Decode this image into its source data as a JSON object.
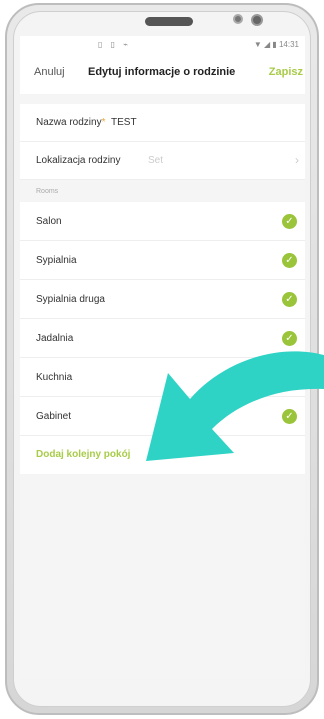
{
  "status_bar": {
    "left_icons": "▯ ▯ ⌁",
    "right_text": "▼ ◢ ▮ 14:31"
  },
  "navbar": {
    "cancel_label": "Anuluj",
    "title": "Edytuj informacje o rodzinie",
    "save_label": "Zapisz"
  },
  "form": {
    "family_name_label": "Nazwa rodziny",
    "required_mark": "*",
    "family_name_value": "TEST",
    "location_label": "Lokalizacja rodziny",
    "location_value": "Set",
    "chevron": "›"
  },
  "rooms": {
    "section_label": "Rooms",
    "check_glyph": "✓",
    "items": [
      {
        "label": "Salon"
      },
      {
        "label": "Sypialnia"
      },
      {
        "label": "Sypialnia druga"
      },
      {
        "label": "Jadalnia"
      },
      {
        "label": "Kuchnia"
      },
      {
        "label": "Gabinet"
      }
    ],
    "add_label": "Dodaj kolejny pokój"
  },
  "colors": {
    "accent": "#a8cc48",
    "check": "#9ac43a",
    "arrow": "#2ed3c6"
  }
}
